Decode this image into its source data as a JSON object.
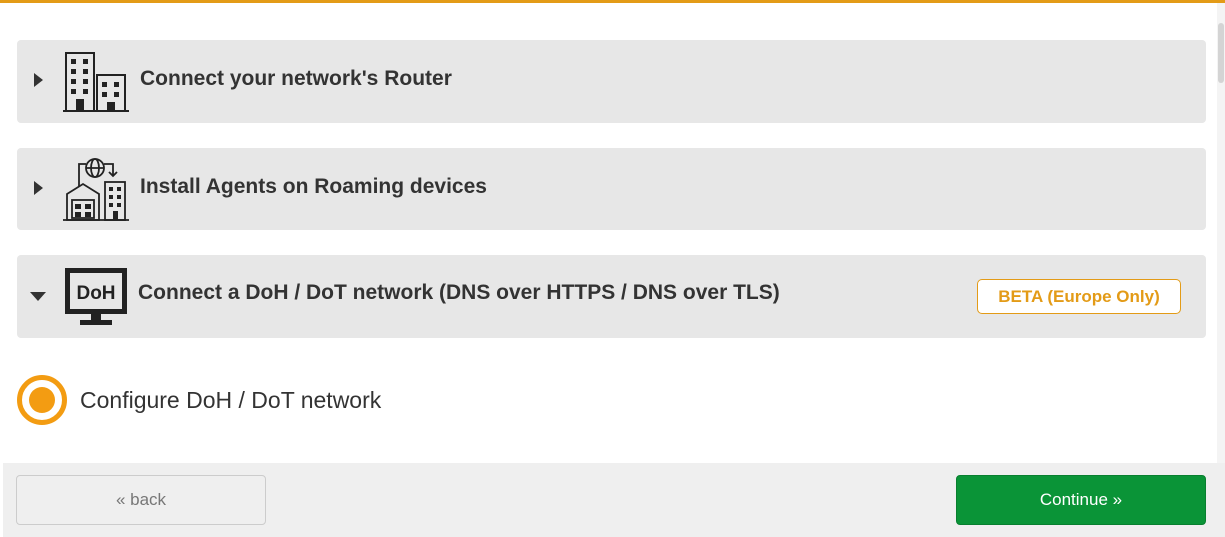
{
  "sections": [
    {
      "title": "Connect your network's Router",
      "icon": "office-buildings-icon",
      "expanded": false
    },
    {
      "title": "Install Agents on Roaming devices",
      "icon": "roaming-devices-network-icon",
      "expanded": false
    },
    {
      "title": "Connect a DoH / DoT network (DNS over HTTPS / DNS over TLS)",
      "icon": "doh-monitor-icon",
      "expanded": true,
      "badge": "BETA (Europe Only)",
      "icon_text": "DoH"
    }
  ],
  "option": {
    "label": "Configure DoH / DoT network",
    "selected": true
  },
  "footer": {
    "back_label": "« back",
    "continue_label": "Continue »"
  },
  "colors": {
    "accent": "#e39b17",
    "radio": "#f39c12",
    "continue_bg": "#0a9437",
    "panel_bg": "#e7e7e7"
  }
}
